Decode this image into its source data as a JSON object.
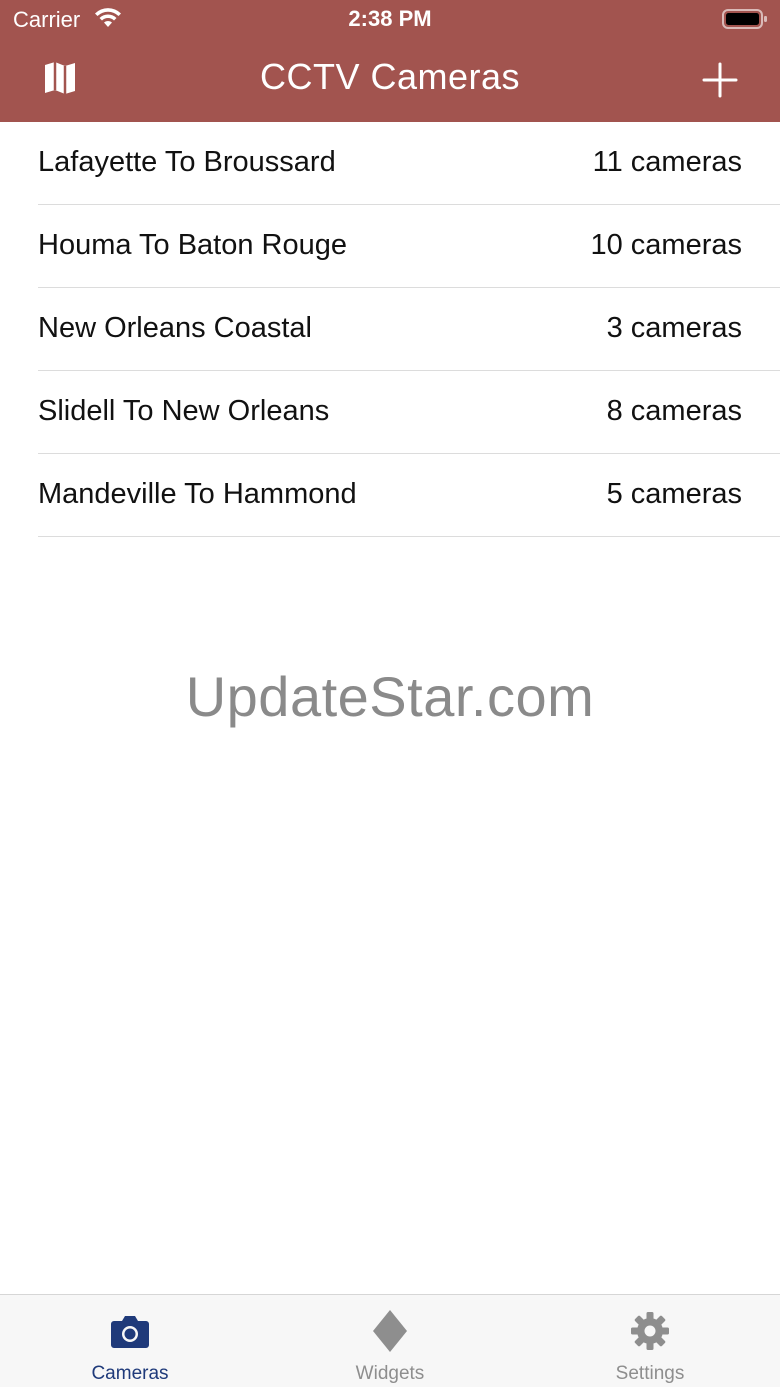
{
  "status_bar": {
    "carrier": "Carrier",
    "time": "2:38 PM"
  },
  "nav": {
    "title": "CCTV Cameras",
    "left_icon": "map-icon",
    "right_icon": "plus-icon"
  },
  "list": {
    "items": [
      {
        "label": "Lafayette To Broussard",
        "count": "11 cameras"
      },
      {
        "label": "Houma To Baton Rouge",
        "count": "10 cameras"
      },
      {
        "label": "New Orleans Coastal",
        "count": "3 cameras"
      },
      {
        "label": "Slidell To New Orleans",
        "count": "8 cameras"
      },
      {
        "label": "Mandeville To Hammond",
        "count": "5 cameras"
      }
    ]
  },
  "watermark": "UpdateStar.com",
  "tabs": [
    {
      "label": "Cameras",
      "icon": "camera-icon",
      "active": true
    },
    {
      "label": "Widgets",
      "icon": "diamond-icon",
      "active": false
    },
    {
      "label": "Settings",
      "icon": "gear-icon",
      "active": false
    }
  ],
  "colors": {
    "header_bg": "#a2544f",
    "active_tab": "#1f3a7a",
    "inactive_tab": "#8e8e8e"
  }
}
